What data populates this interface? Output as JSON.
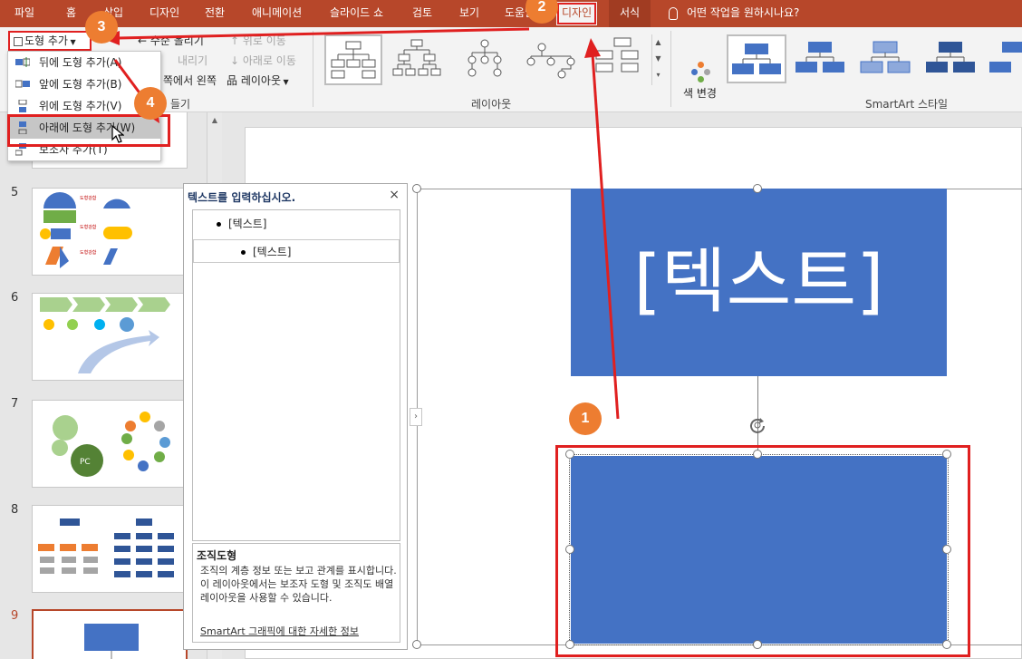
{
  "tabs": [
    {
      "label": "파일"
    },
    {
      "label": "홈"
    },
    {
      "label": "삽입"
    },
    {
      "label": "디자인"
    },
    {
      "label": "전환"
    },
    {
      "label": "애니메이션"
    },
    {
      "label": "슬라이드 쇼"
    },
    {
      "label": "검토"
    },
    {
      "label": "보기"
    },
    {
      "label": "도움말"
    },
    {
      "label": "디자인"
    },
    {
      "label": "서식"
    }
  ],
  "tell_me": "어떤 작업을 원하시나요?",
  "ribbon": {
    "add_shape": "도형 추가",
    "promote": "수준 올리기",
    "demote": "내리기",
    "move_up": "위로 이동",
    "move_down": "아래로 이동",
    "rtl": "쪽에서 왼쪽",
    "layout_btn": "레이아웃",
    "create_group_label": "들기",
    "layouts_label": "레이아웃",
    "change_colors": "색 변경",
    "styles_label": "SmartArt 스타일"
  },
  "dropdown": {
    "items": [
      {
        "label": "뒤에 도형 추가(A)"
      },
      {
        "label": "앞에 도형 추가(B)"
      },
      {
        "label": "위에 도형 추가(V)"
      },
      {
        "label": "아래에 도형 추가(W)"
      },
      {
        "label": "보조자 추가(T)"
      }
    ]
  },
  "thumbnails": [
    {
      "num": "5"
    },
    {
      "num": "6"
    },
    {
      "num": "7"
    },
    {
      "num": "8"
    },
    {
      "num": "9"
    }
  ],
  "text_pane": {
    "title": "텍스트를 입력하십시오.",
    "close": "×",
    "items": [
      "[텍스트]",
      "[텍스트]"
    ],
    "desc_title": "조직도형",
    "desc_body": "조직의 계층 정보 또는 보고 관계를 표시합니다. 이 레이아웃에서는 보조자 도형 및 조직도 배열 레이아웃을 사용할 수 있습니다.",
    "link": "SmartArt 그래픽에 대한 자세한 정보"
  },
  "slide": {
    "top_box_text": "[텍스트]"
  },
  "callouts": [
    "1",
    "2",
    "3",
    "4"
  ],
  "colors": {
    "accent": "#b7472a",
    "shape": "#4472c4",
    "callout": "#ed7d31",
    "highlight": "#e02020"
  }
}
